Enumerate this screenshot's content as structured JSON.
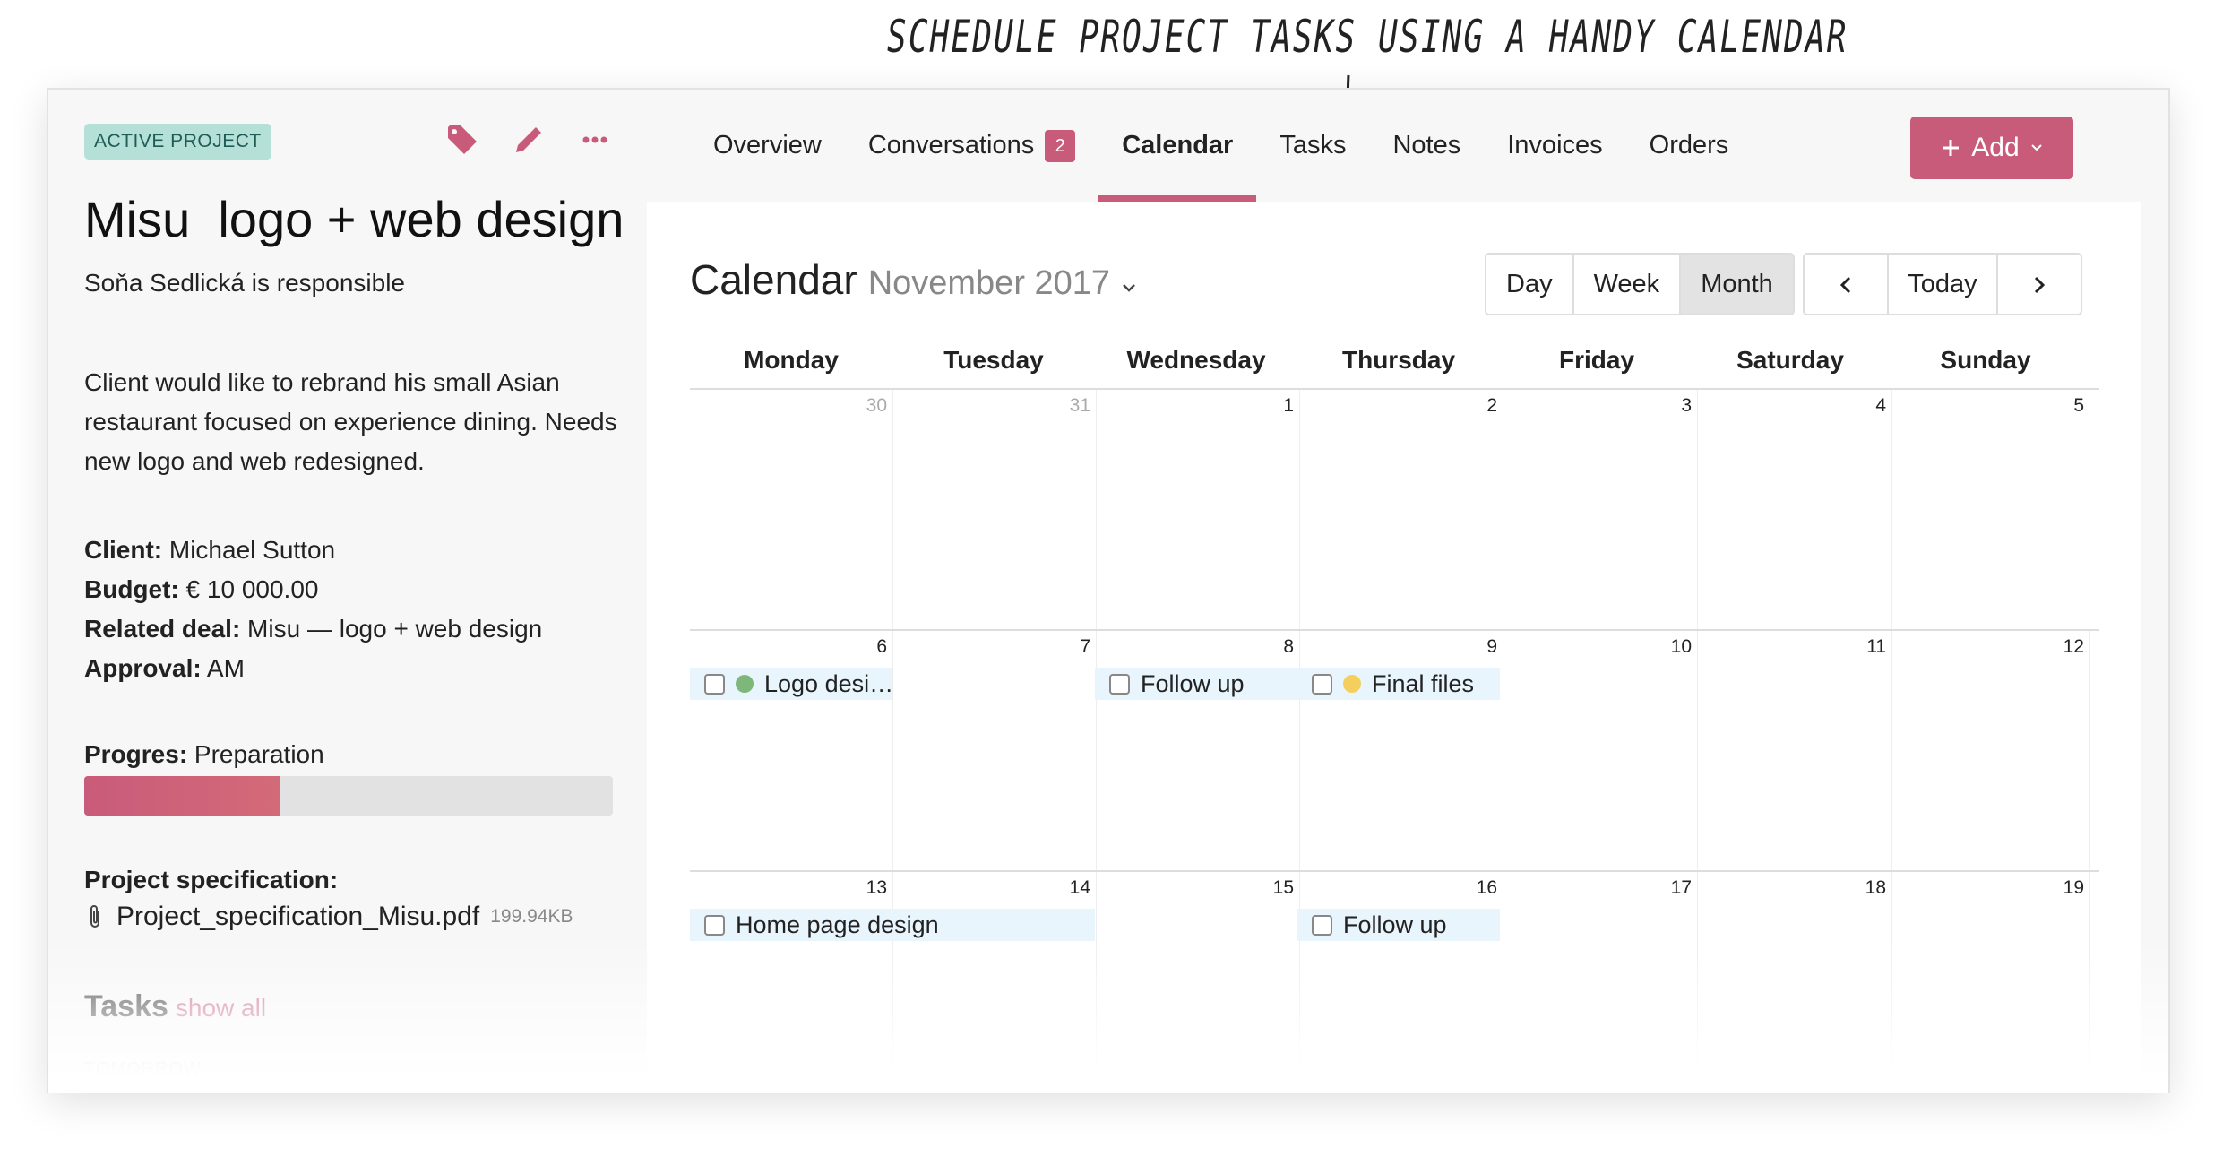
{
  "headline": "SCHEDULE PROJECT TASKS USING A HANDY CALENDAR",
  "sidebar": {
    "badge": "ACTIVE PROJECT",
    "icons": [
      "tag-icon",
      "pencil-icon",
      "more-icon"
    ],
    "title": "Misu  logo + web design",
    "responsible": "Soňa Sedlická is responsible",
    "description": "Client would like to rebrand his small Asian restaurant focused on experience dining. Needs new logo and web redesigned.",
    "fields": [
      {
        "label": "Client:",
        "value": " Michael Sutton"
      },
      {
        "label": "Budget:",
        "value": " € 10 000.00"
      },
      {
        "label": "Related deal:",
        "value": " Misu — logo + web design"
      },
      {
        "label": "Approval:",
        "value": " AM"
      }
    ],
    "progress_label": "Progres:",
    "progress_value": " Preparation",
    "progress_fraction": 0.37,
    "spec_label": "Project specification:",
    "spec_file": "Project_specification_Misu.pdf",
    "spec_size": "199.94KB",
    "tasks_title": "Tasks",
    "tasks_show_all": "show all",
    "tasks_next": "TOMORROW"
  },
  "tabs": [
    {
      "label": "Overview"
    },
    {
      "label": "Conversations",
      "count": "2"
    },
    {
      "label": "Calendar",
      "active": true
    },
    {
      "label": "Tasks"
    },
    {
      "label": "Notes"
    },
    {
      "label": "Invoices"
    },
    {
      "label": "Orders"
    }
  ],
  "add_button": "Add",
  "accent_color": "#c95b7a",
  "calendar": {
    "title": "Calendar",
    "month": "November 2017",
    "views": [
      "Day",
      "Week",
      "Month"
    ],
    "selected_view": "Month",
    "nav": {
      "prev": "‹",
      "today": "Today",
      "next": "›"
    },
    "weekdays": [
      "Monday",
      "Tuesday",
      "Wednesday",
      "Thursday",
      "Friday",
      "Saturday",
      "Sunday"
    ],
    "weeks": [
      {
        "days": [
          {
            "n": "30",
            "muted": true
          },
          {
            "n": "31",
            "muted": true
          },
          {
            "n": "1"
          },
          {
            "n": "2"
          },
          {
            "n": "3"
          },
          {
            "n": "4"
          },
          {
            "n": "5"
          }
        ],
        "events": []
      },
      {
        "days": [
          {
            "n": "6"
          },
          {
            "n": "7"
          },
          {
            "n": "8"
          },
          {
            "n": "9"
          },
          {
            "n": "10"
          },
          {
            "n": "11"
          },
          {
            "n": "12"
          }
        ],
        "events": [
          {
            "label": "Logo desi…",
            "start": 0,
            "span": 1,
            "dot": "#7db87a"
          },
          {
            "label": "Follow up",
            "start": 2,
            "span": 1
          },
          {
            "label": "Final files",
            "start": 3,
            "span": 1,
            "dot": "#f5cf5e"
          }
        ]
      },
      {
        "days": [
          {
            "n": "13"
          },
          {
            "n": "14"
          },
          {
            "n": "15"
          },
          {
            "n": "16"
          },
          {
            "n": "17"
          },
          {
            "n": "18"
          },
          {
            "n": "19"
          }
        ],
        "events": [
          {
            "label": "Home page design",
            "start": 0,
            "span": 2
          },
          {
            "label": "Follow up",
            "start": 3,
            "span": 1
          }
        ]
      }
    ]
  }
}
